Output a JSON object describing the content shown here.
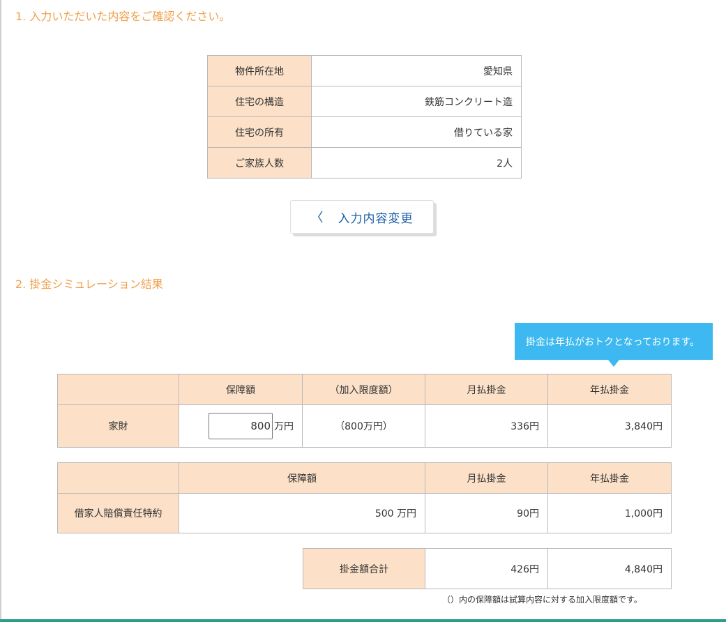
{
  "section1": {
    "title": "1. 入力いただいた内容をご確認ください。"
  },
  "confirm": {
    "rows": [
      {
        "label": "物件所在地",
        "value": "愛知県"
      },
      {
        "label": "住宅の構造",
        "value": "鉄筋コンクリート造"
      },
      {
        "label": "住宅の所有",
        "value": "借りている家"
      },
      {
        "label": "ご家族人数",
        "value": "2人"
      }
    ],
    "change_button": "入力内容変更"
  },
  "section2": {
    "title": "2. 掛金シミュレーション結果"
  },
  "tooltip": "掛金は年払がおトクとなっております。",
  "kazai": {
    "headers": {
      "coverage": "保障額",
      "limit": "（加入限度額）",
      "monthly": "月払掛金",
      "annual": "年払掛金"
    },
    "label": "家財",
    "amount_input": "800",
    "amount_unit": "万円",
    "limit": "（800万円）",
    "monthly": "336円",
    "annual": "3,840円"
  },
  "shakuya": {
    "headers": {
      "coverage": "保障額",
      "monthly": "月払掛金",
      "annual": "年払掛金"
    },
    "label": "借家人賠償責任特約",
    "amount": "500 万円",
    "monthly": "90円",
    "annual": "1,000円"
  },
  "total": {
    "label": "掛金額合計",
    "monthly": "426円",
    "annual": "4,840円"
  },
  "footnote": "（）内の保障額は試算内容に対する加入限度額です。"
}
